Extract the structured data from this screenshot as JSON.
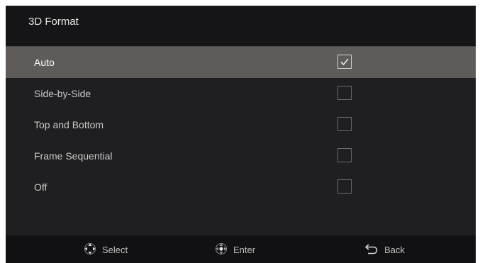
{
  "header": {
    "title": "3D Format"
  },
  "menu": {
    "items": [
      {
        "label": "Auto",
        "checked": true,
        "selected": true
      },
      {
        "label": "Side-by-Side",
        "checked": false,
        "selected": false
      },
      {
        "label": "Top and Bottom",
        "checked": false,
        "selected": false
      },
      {
        "label": "Frame Sequential",
        "checked": false,
        "selected": false
      },
      {
        "label": "Off",
        "checked": false,
        "selected": false
      }
    ]
  },
  "footer": {
    "select_label": "Select",
    "enter_label": "Enter",
    "back_label": "Back",
    "select_icon": "dpad-icon",
    "enter_icon": "dpad-enter-icon",
    "back_icon": "back-arrow-icon"
  },
  "colors": {
    "background": "#1f1f21",
    "header": "#151517",
    "highlight": "#5e5b59",
    "footer": "#111113"
  }
}
